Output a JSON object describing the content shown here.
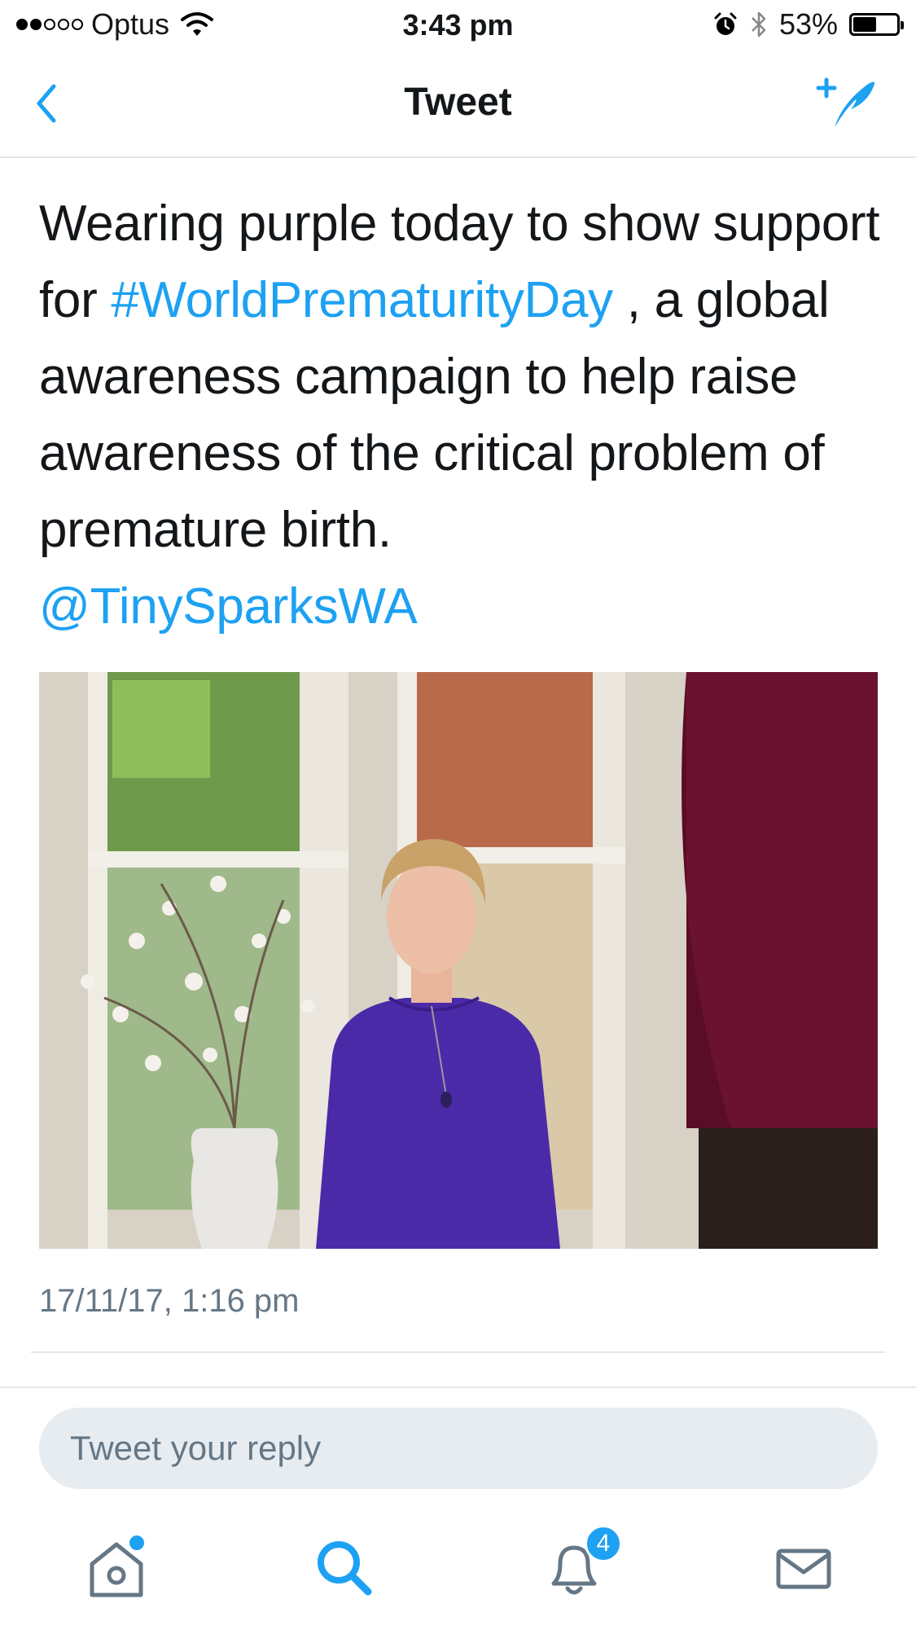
{
  "status_bar": {
    "carrier": "Optus",
    "time": "3:43 pm",
    "battery_percent": "53%",
    "battery_level": 0.53,
    "signal_bars_filled": 2,
    "signal_bars_total": 5,
    "icons": [
      "wifi-icon",
      "alarm-icon",
      "bluetooth-icon",
      "battery-icon"
    ]
  },
  "nav": {
    "title": "Tweet",
    "back_icon": "chevron-left-icon",
    "compose_icon": "compose-tweet-icon"
  },
  "tweet": {
    "text_before_hashtag": "Wearing purple today to show support for ",
    "hashtag": "#WorldPrematurityDay",
    "text_after_hashtag": " , a global awareness campaign to help raise awareness of the critical problem of premature birth.",
    "mention": "@TinySparksWA",
    "media": "photo",
    "timestamp": "17/11/17, 1:16 pm"
  },
  "reply": {
    "placeholder": "Tweet your reply"
  },
  "tab_bar": {
    "home_icon": "home-icon",
    "search_icon": "search-icon",
    "notifications_icon": "bell-icon",
    "notifications_count": "4",
    "messages_icon": "mail-icon"
  },
  "colors": {
    "accent": "#1da1f2",
    "text": "#14171a",
    "secondary_text": "#657786",
    "divider": "#e1e8ed",
    "reply_bg": "#e6ecf0"
  }
}
